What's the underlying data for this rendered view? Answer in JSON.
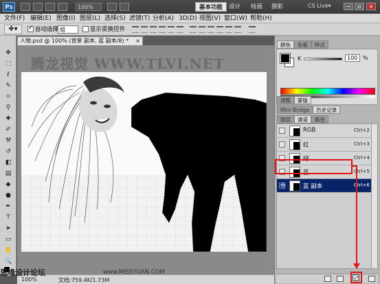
{
  "appbar": {
    "logo": "Ps",
    "zoom": "100%",
    "workspaces": [
      "基本功能",
      "设计",
      "绘画",
      "摄影"
    ],
    "active_workspace": "基本功能",
    "cs_live": "CS Live▾",
    "window_buttons": [
      "−",
      "▫",
      "×"
    ]
  },
  "menubar": {
    "items": [
      "文件(F)",
      "编辑(E)",
      "图像(I)",
      "图层(L)",
      "选择(S)",
      "滤镜(T)",
      "分析(A)",
      "3D(D)",
      "视图(V)",
      "窗口(W)",
      "帮助(H)"
    ]
  },
  "options": {
    "auto_select_label": "自动选择:",
    "auto_select_value": "组",
    "show_transform_label": "显示变换控件"
  },
  "document": {
    "tab_title": "人物.psd @ 100% (背景 副本, 蓝 副本/8) *",
    "tab_close": "×",
    "watermark": "腾龙视觉 WWW.TLVI.NET",
    "zoom": "100%",
    "doc_info": "文档:759.4K/1.73M"
  },
  "footer": {
    "site_watermark": "思缘设计论坛",
    "site_url": "www.MISSYUAN.COM"
  },
  "color_panel": {
    "tabs": [
      "颜色",
      "色板",
      "样式"
    ],
    "active_tab": "颜色",
    "k_label": "K",
    "k_value": "100",
    "k_unit": "%"
  },
  "adjust_panel": {
    "tabs": [
      "调整",
      "蒙版"
    ],
    "active_tab": "蒙版"
  },
  "bridge_panel": {
    "tabs": [
      "Mini Bridge",
      "历史记录"
    ],
    "active_tab": "历史记录"
  },
  "channels_panel": {
    "tabs": [
      "图层",
      "通道",
      "路径"
    ],
    "active_tab": "通道",
    "rows": [
      {
        "name": "RGB",
        "shortcut": "Ctrl+2"
      },
      {
        "name": "红",
        "shortcut": "Ctrl+3"
      },
      {
        "name": "绿",
        "shortcut": "Ctrl+4"
      },
      {
        "name": "蓝",
        "shortcut": "Ctrl+5"
      },
      {
        "name": "蓝 副本",
        "shortcut": "Ctrl+6"
      }
    ]
  },
  "colors": {
    "selection_highlight": "#0a246a",
    "annotation_red": "#e01414",
    "ps_blue": "#1b5e9a"
  }
}
